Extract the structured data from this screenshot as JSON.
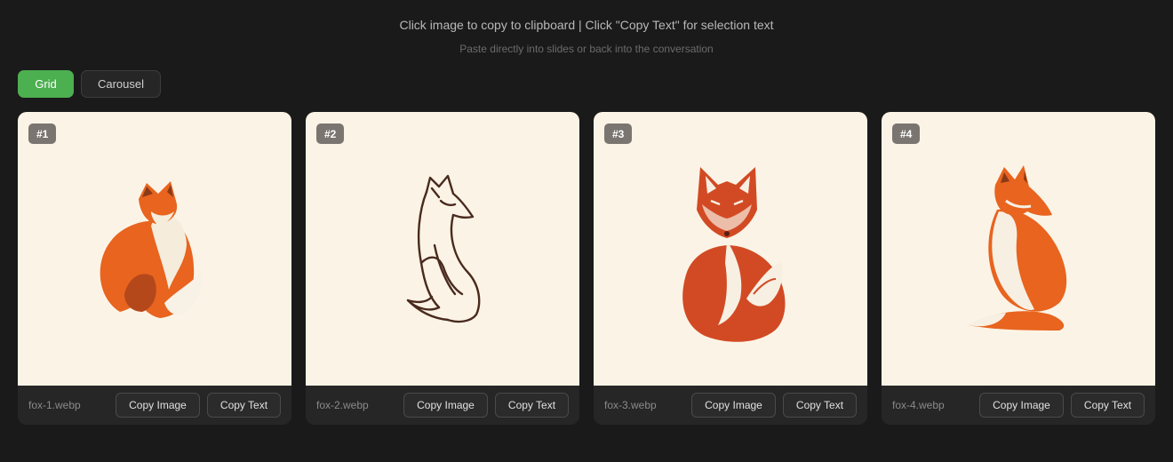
{
  "header": {
    "title": "Click image to copy to clipboard | Click \"Copy Text\" for selection text",
    "subtitle": "Paste directly into slides or back into the conversation"
  },
  "view_toggle": {
    "grid_label": "Grid",
    "carousel_label": "Carousel",
    "active": "Grid"
  },
  "cards": [
    {
      "badge": "#1",
      "filename": "fox-1.webp",
      "copy_image_label": "Copy Image",
      "copy_text_label": "Copy Text"
    },
    {
      "badge": "#2",
      "filename": "fox-2.webp",
      "copy_image_label": "Copy Image",
      "copy_text_label": "Copy Text"
    },
    {
      "badge": "#3",
      "filename": "fox-3.webp",
      "copy_image_label": "Copy Image",
      "copy_text_label": "Copy Text"
    },
    {
      "badge": "#4",
      "filename": "fox-4.webp",
      "copy_image_label": "Copy Image",
      "copy_text_label": "Copy Text"
    }
  ],
  "colors": {
    "accent": "#4caf50",
    "background": "#1a1a1a",
    "card_image_bg": "#fbf4e6",
    "fox_orange": "#e8641f",
    "fox_red": "#d24a24",
    "line_art": "#4a2a1e"
  }
}
